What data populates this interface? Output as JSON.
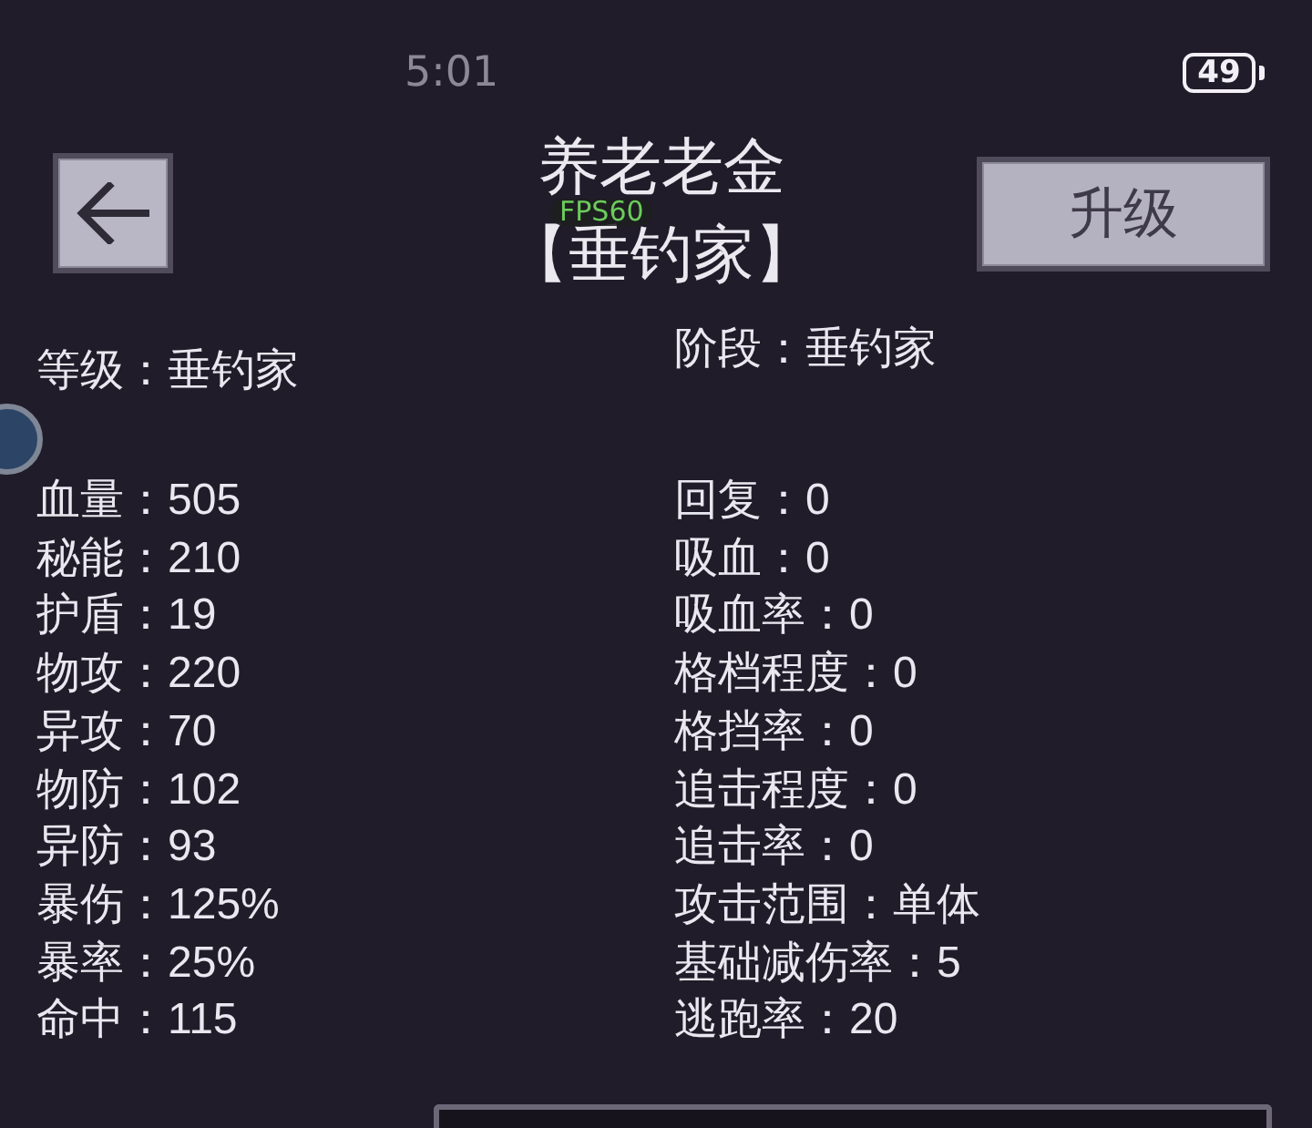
{
  "status_bar": {
    "time": "5:01",
    "battery": "49"
  },
  "header": {
    "title": "养老老金",
    "subtitle": "【垂钓家】",
    "upgrade_button": "升级"
  },
  "fps_overlay": "FPS60",
  "info": {
    "level": "等级：垂钓家",
    "stage": "阶段：垂钓家"
  },
  "stats": {
    "left": [
      "血量：505",
      "秘能：210",
      "护盾：19",
      "物攻：220",
      "异攻：70",
      "物防：102",
      "异防：93",
      "暴伤：125%",
      "暴率：25%",
      "命中：115"
    ],
    "right": [
      "回复：0",
      "吸血：0",
      "吸血率：0",
      "格档程度：0",
      "格挡率：0",
      "追击程度：0",
      "追击率：0",
      "攻击范围：单体",
      "基础减伤率：5",
      "逃跑率：20"
    ]
  }
}
